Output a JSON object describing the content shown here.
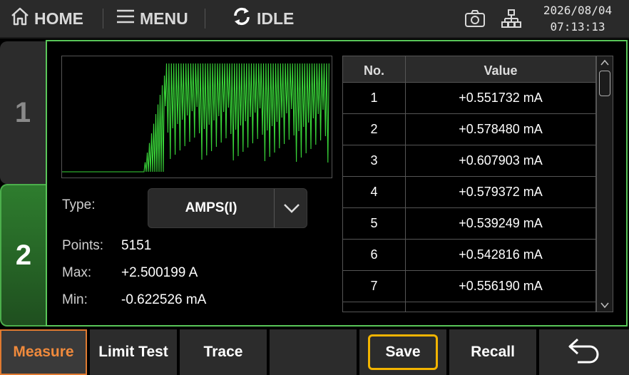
{
  "topbar": {
    "home_label": "HOME",
    "home_icon": "home-icon",
    "menu_label": "MENU",
    "menu_icon": "hamburger-icon",
    "status_label": "IDLE",
    "status_icon": "refresh-icon",
    "camera_icon": "camera-icon",
    "network_icon": "network-icon",
    "date": "2026/08/04",
    "time": "07:13:13"
  },
  "tabs": [
    {
      "label": "1"
    },
    {
      "label": "2",
      "active": true
    }
  ],
  "measure": {
    "type_label": "Type:",
    "type_value": "AMPS(I)",
    "points_label": "Points:",
    "points_value": "5151",
    "max_label": "Max:",
    "max_value": "+2.500199 A",
    "min_label": "Min:",
    "min_value": "-0.622526 mA"
  },
  "table": {
    "col_no": "No.",
    "col_value": "Value",
    "rows": [
      {
        "no": "1",
        "value": "+0.551732 mA"
      },
      {
        "no": "2",
        "value": "+0.578480 mA"
      },
      {
        "no": "3",
        "value": "+0.607903 mA"
      },
      {
        "no": "4",
        "value": "+0.579372 mA"
      },
      {
        "no": "5",
        "value": "+0.539249 mA"
      },
      {
        "no": "6",
        "value": "+0.542816 mA"
      },
      {
        "no": "7",
        "value": "+0.556190 mA"
      }
    ]
  },
  "toolbar": {
    "measure": "Measure",
    "limit_test": "Limit Test",
    "trace": "Trace",
    "blank": "",
    "save": "Save",
    "recall": "Recall",
    "back_icon": "back-arrow-icon"
  },
  "colors": {
    "accent_green": "#59c659",
    "trace_green": "#39d639",
    "active_orange": "#f08a3c",
    "focus_yellow": "#f2b400"
  }
}
